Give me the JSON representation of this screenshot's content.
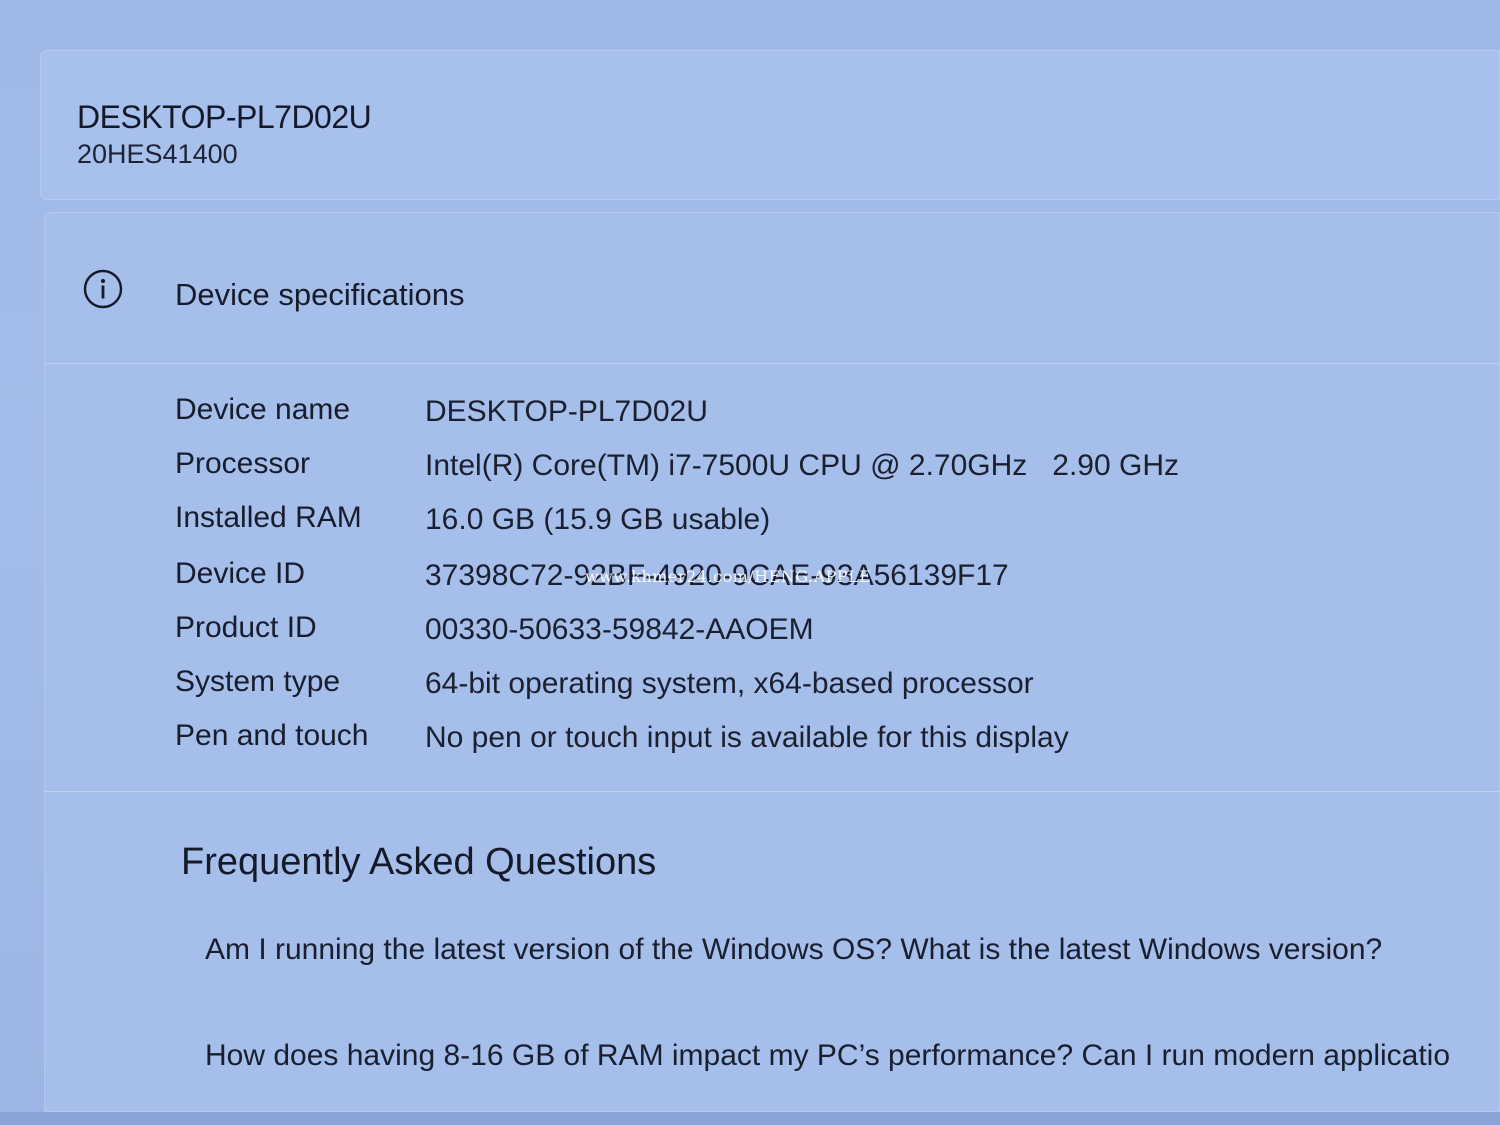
{
  "device": {
    "name": "DESKTOP-PL7D02U",
    "model": "20HES41400"
  },
  "specifications": {
    "title": "Device specifications",
    "icon": "info-icon",
    "rows": [
      {
        "label": "Device name",
        "value": "DESKTOP-PL7D02U"
      },
      {
        "label": "Processor",
        "value": "Intel(R) Core(TM) i7-7500U CPU @ 2.70GHz   2.90 GHz"
      },
      {
        "label": "Installed RAM",
        "value": "16.0 GB (15.9 GB usable)"
      },
      {
        "label": "Device ID",
        "value": "37398C72-92BF-4920-9CAE-93A56139F17"
      },
      {
        "label": "Product ID",
        "value": "00330-50633-59842-AAOEM"
      },
      {
        "label": "System type",
        "value": "64-bit operating system, x64-based processor"
      },
      {
        "label": "Pen and touch",
        "value": "No pen or touch input is available for this display"
      }
    ]
  },
  "watermark": "www.khmer24.com/HENG.APPLE",
  "faq": {
    "title": "Frequently Asked Questions",
    "items": [
      "Am I running the latest version of the Windows OS? What is the latest Windows version?",
      "How does having 8-16 GB of RAM impact my PC’s performance? Can I run modern applicatio"
    ]
  }
}
